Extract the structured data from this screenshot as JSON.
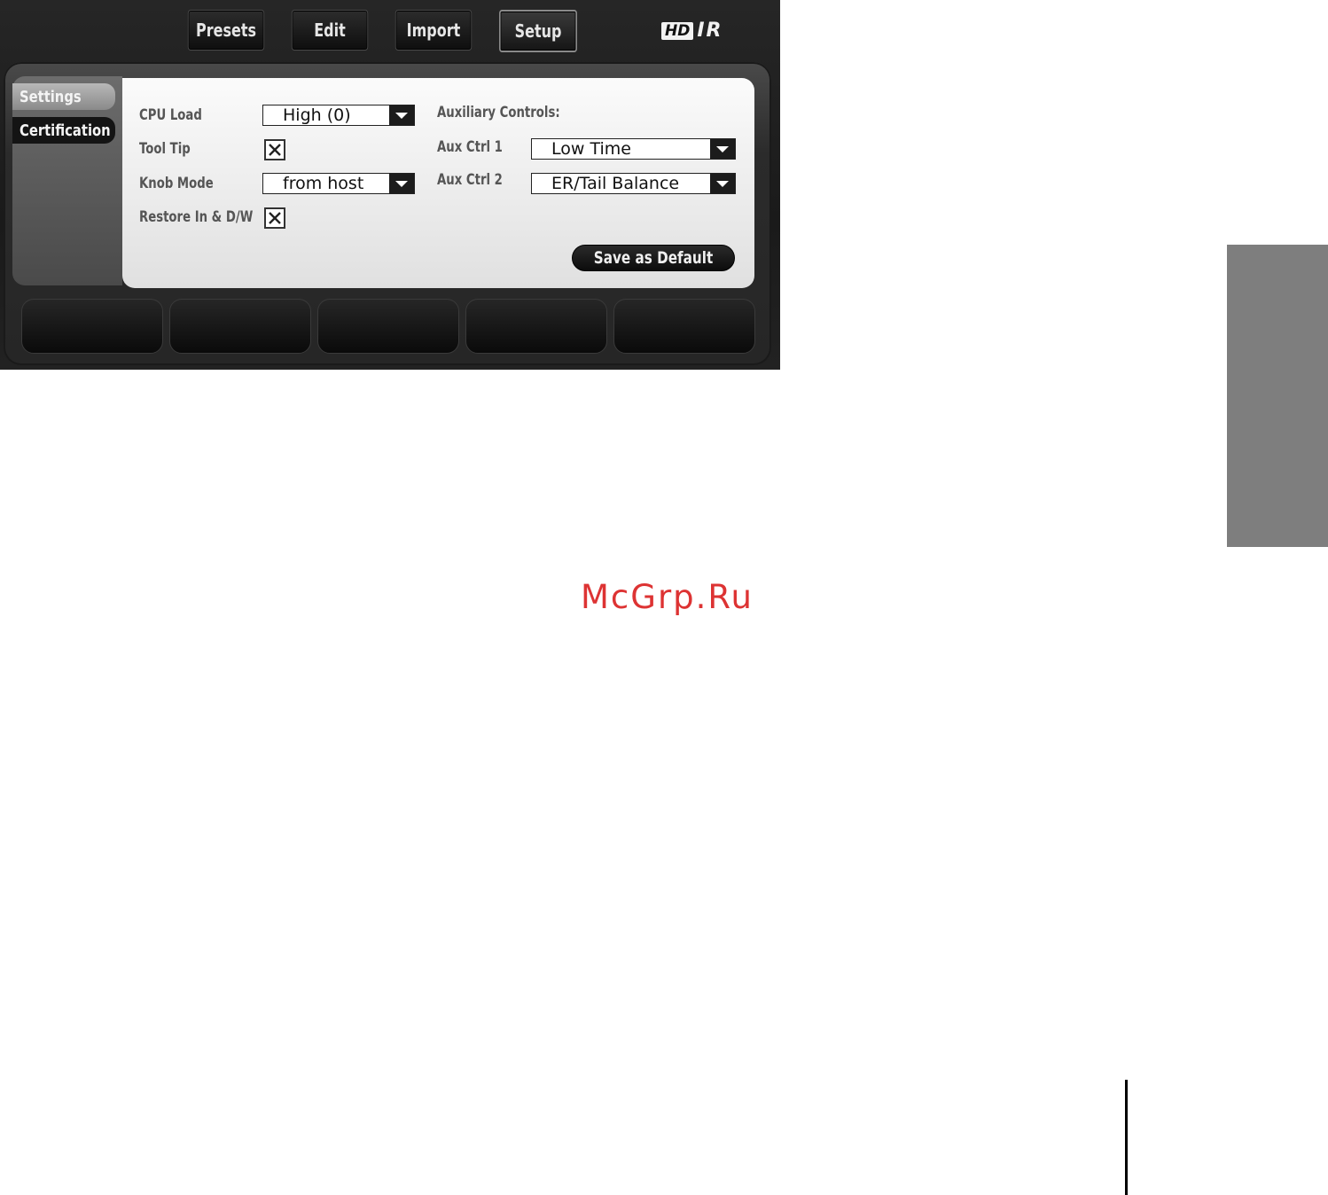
{
  "header": {
    "tabs": [
      {
        "label": "Presets"
      },
      {
        "label": "Edit"
      },
      {
        "label": "Import"
      },
      {
        "label": "Setup",
        "active": true
      }
    ],
    "logo": {
      "hd": "HD",
      "ir": "IR"
    }
  },
  "sidebar": {
    "items": [
      {
        "label": "Settings",
        "active": true
      },
      {
        "label": "Certification"
      }
    ]
  },
  "settings": {
    "cpu_load": {
      "label": "CPU Load",
      "value": "High (0)"
    },
    "tool_tip": {
      "label": "Tool Tip",
      "checked": true
    },
    "knob_mode": {
      "label": "Knob Mode",
      "value": "from host"
    },
    "restore": {
      "label": "Restore In & D/W",
      "checked": true
    },
    "aux_title": "Auxiliary Controls:",
    "aux1": {
      "label": "Aux Ctrl 1",
      "value": "Low Time"
    },
    "aux2": {
      "label": "Aux Ctrl 2",
      "value": "ER/Tail Balance"
    },
    "save_label": "Save as Default"
  },
  "watermark": "McGrp.Ru",
  "colors": {
    "accent": "#dd3333",
    "panel": "#eeeeee",
    "chrome": "#1a1a1a",
    "side_block": "#7e7e7e"
  }
}
